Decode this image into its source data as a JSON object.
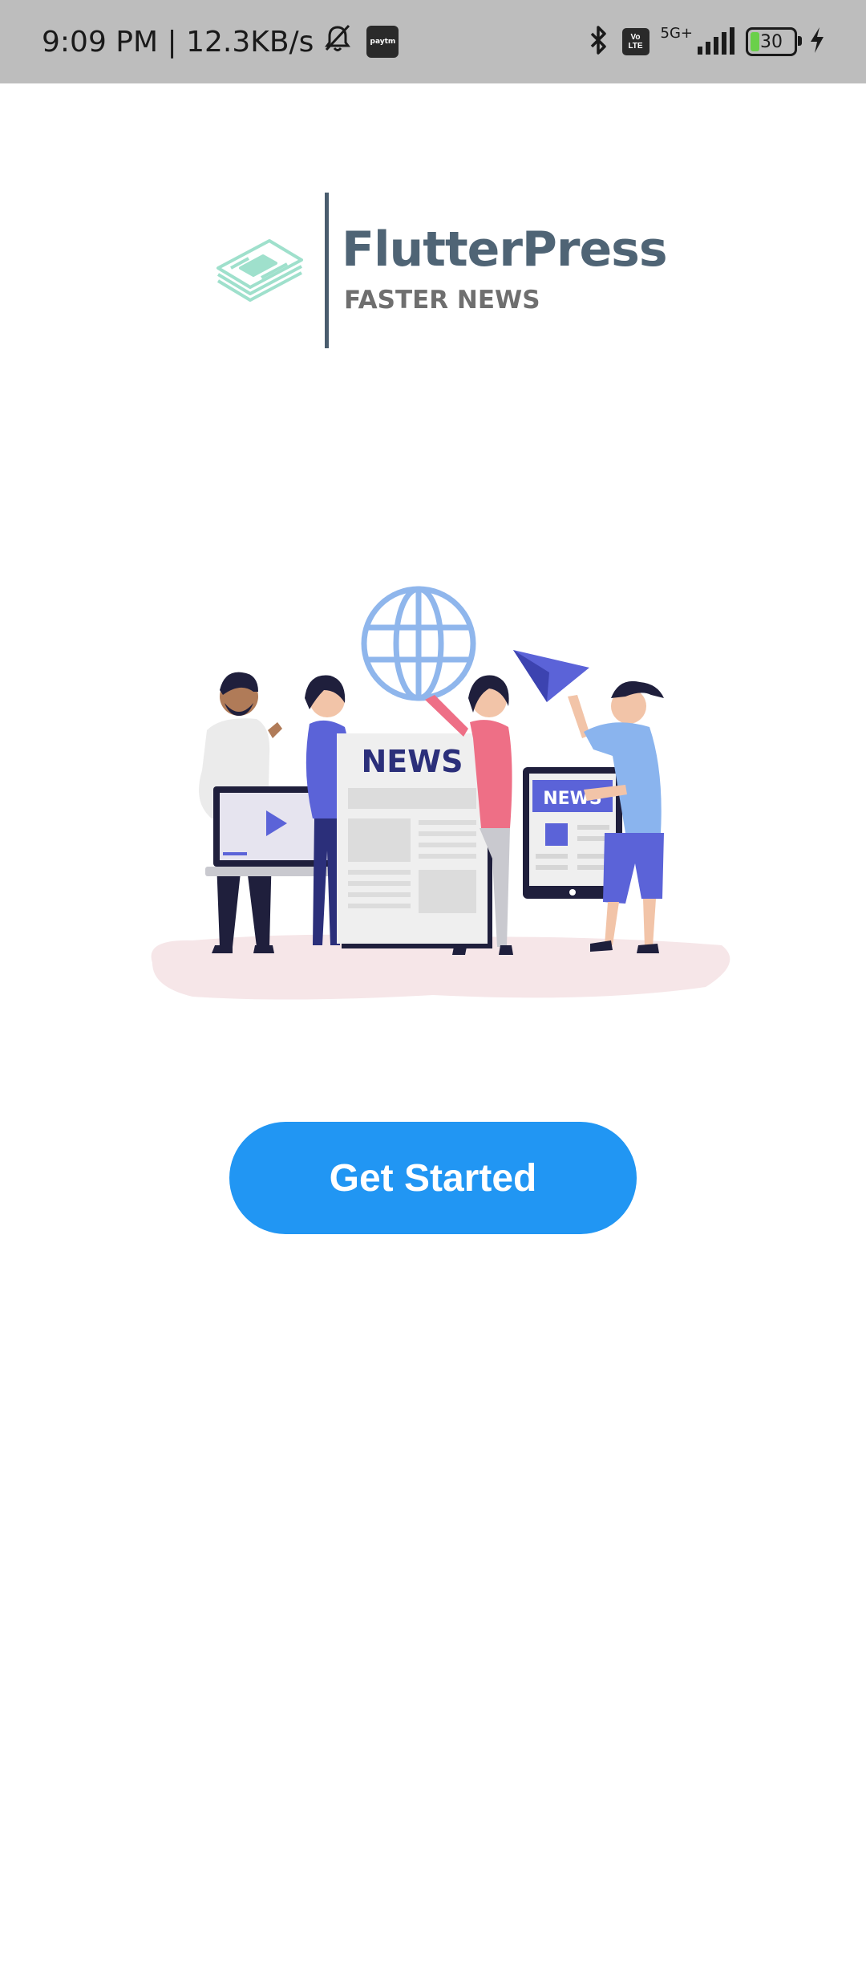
{
  "status_bar": {
    "time_speed": "9:09 PM | 12.3KB/s",
    "paytm_label": "paytm",
    "volte_top": "Vo",
    "volte_bottom": "LTE",
    "network": "5G+",
    "battery_level": "30",
    "battery_fraction": 0.3
  },
  "logo": {
    "title": "FlutterPress",
    "subtitle": "FASTER NEWS"
  },
  "illustration": {
    "newspaper_text": "NEWS",
    "tablet_text": "NEWS"
  },
  "buttons": {
    "get_started": "Get Started"
  },
  "colors": {
    "accent": "#2196f3",
    "status_bar": "#bdbdbd",
    "logo_text": "#4f6475",
    "illustration_blue": "#5b63d8",
    "globe": "#8fb6ec"
  }
}
